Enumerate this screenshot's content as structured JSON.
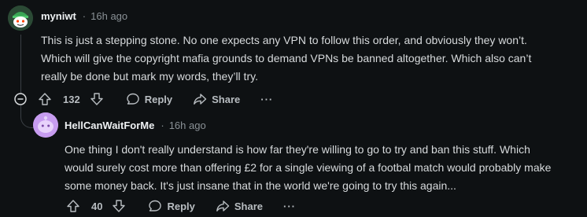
{
  "comments": [
    {
      "username": "myniwt",
      "separator": "·",
      "time": "16h ago",
      "lines": [
        "This is just a stepping stone. No one expects any VPN to follow this order, and obviously they won’t.",
        "Which will give the copyright mafia grounds to demand VPNs be banned altogether. Which also can’t",
        "really be done but mark my words, they’ll try."
      ],
      "votes": "132",
      "reply_label": "Reply",
      "share_label": "Share",
      "more_label": "···"
    },
    {
      "username": "HellCanWaitForMe",
      "separator": "·",
      "time": "16h ago",
      "lines": [
        "One thing I don't really understand is how far they're willing to go to try and ban this stuff. Which",
        "would surely cost more than offering £2 for a single viewing of a footbal match would probably make",
        "some money back. It's just insane that in the world we're going to try this again..."
      ],
      "votes": "40",
      "reply_label": "Reply",
      "share_label": "Share",
      "more_label": "···"
    }
  ],
  "icons": {
    "collapse": "collapse-thread-icon",
    "upvote": "upvote-arrow-icon",
    "downvote": "downvote-arrow-icon",
    "reply": "speech-bubble-icon",
    "share": "share-arrow-icon",
    "more": "overflow-menu-icon"
  },
  "colors": {
    "background": "#0e1113",
    "text": "#d7dadc",
    "meta": "#8a9196",
    "thread_line": "#3a3f44",
    "avatar1_bg": "#2b4a35",
    "avatar2_bg": "#c79cf0"
  }
}
